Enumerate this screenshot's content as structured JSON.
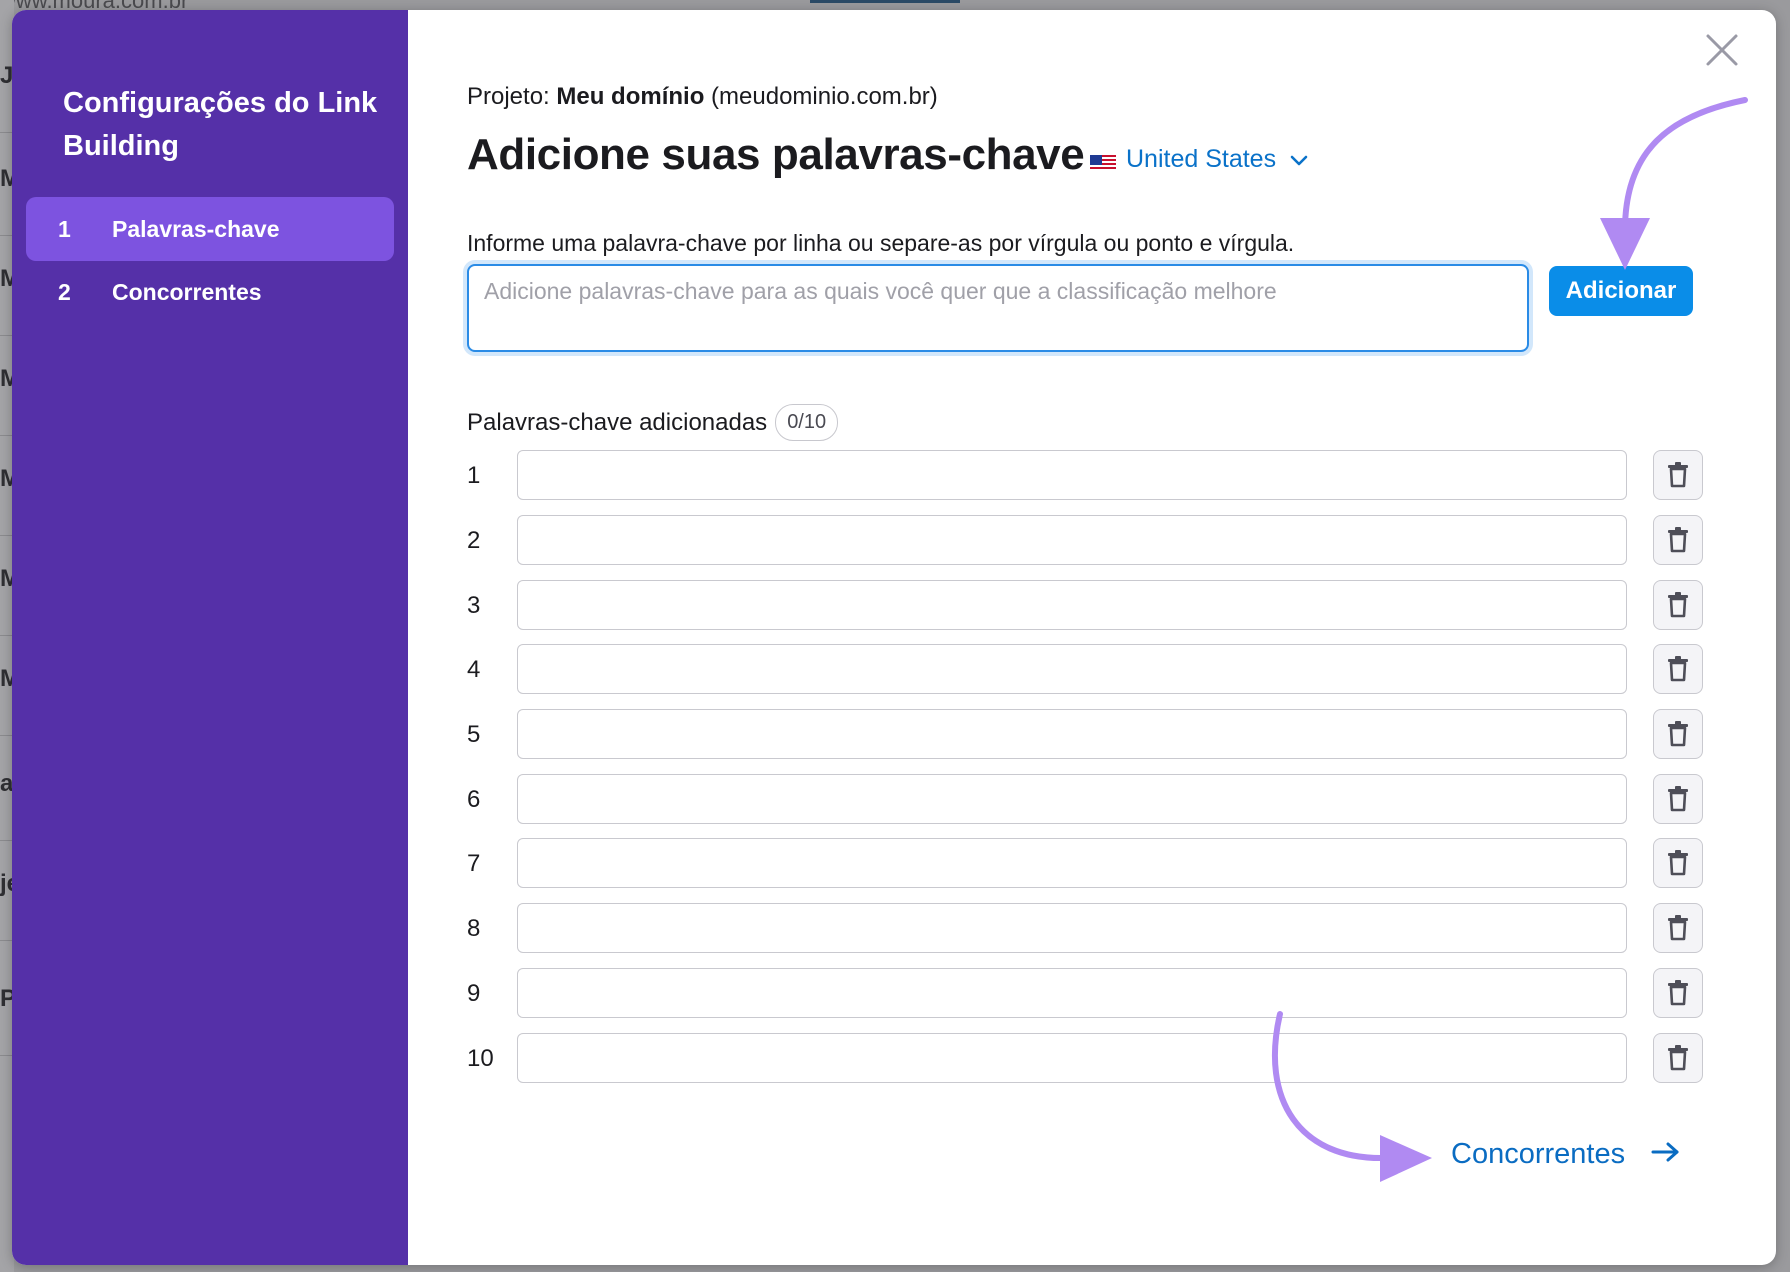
{
  "background": {
    "top_text": "www.moura.com.br",
    "strip_letters": [
      "J",
      "M",
      "M",
      "M",
      "M",
      "M",
      "M",
      "a",
      "je",
      "P"
    ]
  },
  "sidebar": {
    "title": "Configurações do Link Building",
    "items": [
      {
        "num": "1",
        "label": "Palavras-chave",
        "active": true
      },
      {
        "num": "2",
        "label": "Concorrentes",
        "active": false
      }
    ]
  },
  "header": {
    "project_prefix": "Projeto:",
    "project_name": "Meu domínio",
    "project_domain": "(meudominio.com.br)",
    "title": "Adicione suas palavras-chave",
    "country": "United States",
    "country_flag_icon": "us-flag-icon"
  },
  "form": {
    "instruction": "Informe uma palavra-chave por linha ou separe-as por vírgula ou ponto e vírgula.",
    "textarea_placeholder": "Adicione palavras-chave para as quais você quer que a classificação melhore",
    "textarea_value": "",
    "add_label": "Adicionar"
  },
  "keywords": {
    "label": "Palavras-chave adicionadas",
    "counter": "0/10",
    "rows": [
      {
        "num": "1",
        "value": ""
      },
      {
        "num": "2",
        "value": ""
      },
      {
        "num": "3",
        "value": ""
      },
      {
        "num": "4",
        "value": ""
      },
      {
        "num": "5",
        "value": ""
      },
      {
        "num": "6",
        "value": ""
      },
      {
        "num": "7",
        "value": ""
      },
      {
        "num": "8",
        "value": ""
      },
      {
        "num": "9",
        "value": ""
      },
      {
        "num": "10",
        "value": ""
      }
    ]
  },
  "footer": {
    "next_label": "Concorrentes"
  },
  "colors": {
    "sidebar": "#5530a8",
    "sidebar_active": "#7d53e0",
    "primary_button": "#0a8de8",
    "link": "#0a6cc2",
    "annotation_arrow": "#b08af2"
  }
}
